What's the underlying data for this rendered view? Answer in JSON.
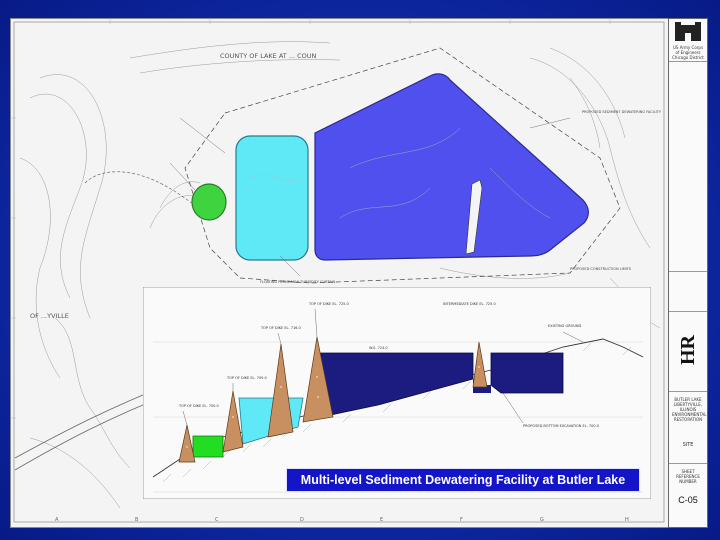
{
  "caption": "Multi-level Sediment Dewatering Facility at Butler Lake",
  "colors": {
    "slide_background": "#0f2aa8",
    "upper_basin": "#5050ee",
    "middle_basin": "#5fe8f5",
    "lower_basin": "#3fd33f",
    "section_water": "#1b1b80",
    "berm": "#c89060",
    "caption_bg": "#1414c8"
  },
  "icons": [
    "usace-castle-logo",
    "hdr-logo"
  ],
  "title_block": {
    "agency": "US Army Corps of Engineers Chicago District",
    "project": "BUTLER LAKE LIBERTYVILLE, ILLINOIS ENVIRONMENTAL RESTORATION",
    "sheet_name": "SITE",
    "sheet_reference": "SHEET REFERENCE NUMBER",
    "sheet_number": "C-05"
  },
  "plan_labels": {
    "county_line": "COUNTY OF LAKE AT ... COUN",
    "town": "OF ...YVILLE",
    "ring": "PROPOSED CONSTRUCTION LIMITS",
    "dewatering": "PROPOSED SEDIMENT DEWATERING FACILITY",
    "turbidity": "FLOATING PERMEABLE TURBIDITY CURTAIN"
  },
  "section_labels": {
    "top_dike_1": "TOP OF DIKE EL. 700.0",
    "top_dike_2": "TOP OF DIKE EL. 709.0",
    "top_dike_3": "TOP OF DIKE EL. 716.0",
    "top_dike_4": "TOP OF DIKE EL. 725.0",
    "existing": "EXISTING GROUND",
    "water": "W.S. 724.0",
    "bottom": "PROPOSED BOTTOM EXCAVATION EL. 700.0",
    "weir": "INTERMEDIATE DIKE EL. 725.0"
  },
  "grid_letters": [
    "A",
    "B",
    "C",
    "D",
    "E",
    "F",
    "G",
    "H"
  ]
}
